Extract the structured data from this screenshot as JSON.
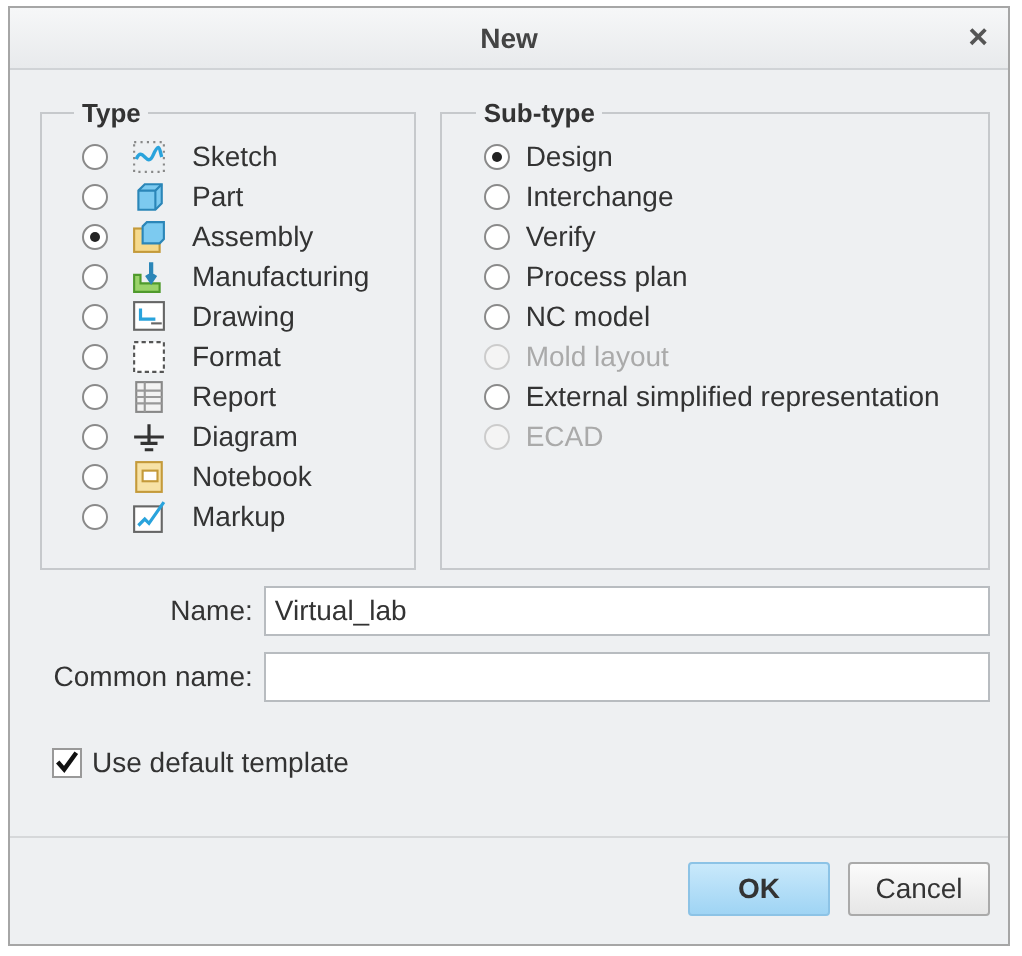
{
  "window": {
    "title": "New",
    "close": "×"
  },
  "type_group": {
    "title": "Type",
    "items": [
      {
        "label": "Sketch",
        "kind": "sketch",
        "selected": false
      },
      {
        "label": "Part",
        "kind": "part",
        "selected": false
      },
      {
        "label": "Assembly",
        "kind": "assembly",
        "selected": true
      },
      {
        "label": "Manufacturing",
        "kind": "manufacturing",
        "selected": false
      },
      {
        "label": "Drawing",
        "kind": "drawing",
        "selected": false
      },
      {
        "label": "Format",
        "kind": "format",
        "selected": false
      },
      {
        "label": "Report",
        "kind": "report",
        "selected": false
      },
      {
        "label": "Diagram",
        "kind": "diagram",
        "selected": false
      },
      {
        "label": "Notebook",
        "kind": "notebook",
        "selected": false
      },
      {
        "label": "Markup",
        "kind": "markup",
        "selected": false
      }
    ]
  },
  "subtype_group": {
    "title": "Sub-type",
    "items": [
      {
        "label": "Design",
        "selected": true,
        "disabled": false
      },
      {
        "label": "Interchange",
        "selected": false,
        "disabled": false
      },
      {
        "label": "Verify",
        "selected": false,
        "disabled": false
      },
      {
        "label": "Process plan",
        "selected": false,
        "disabled": false
      },
      {
        "label": "NC model",
        "selected": false,
        "disabled": false
      },
      {
        "label": "Mold layout",
        "selected": false,
        "disabled": true
      },
      {
        "label": "External simplified representation",
        "selected": false,
        "disabled": false
      },
      {
        "label": "ECAD",
        "selected": false,
        "disabled": true
      }
    ]
  },
  "fields": [
    {
      "label": "Name:",
      "value": "Virtual_lab"
    },
    {
      "label": "Common name:"
    }
  ],
  "use_default_template": {
    "label": "Use default template",
    "checked": true
  },
  "buttons": [
    {
      "label": "OK",
      "primary": true
    },
    {
      "label": "Cancel",
      "primary": false
    }
  ]
}
